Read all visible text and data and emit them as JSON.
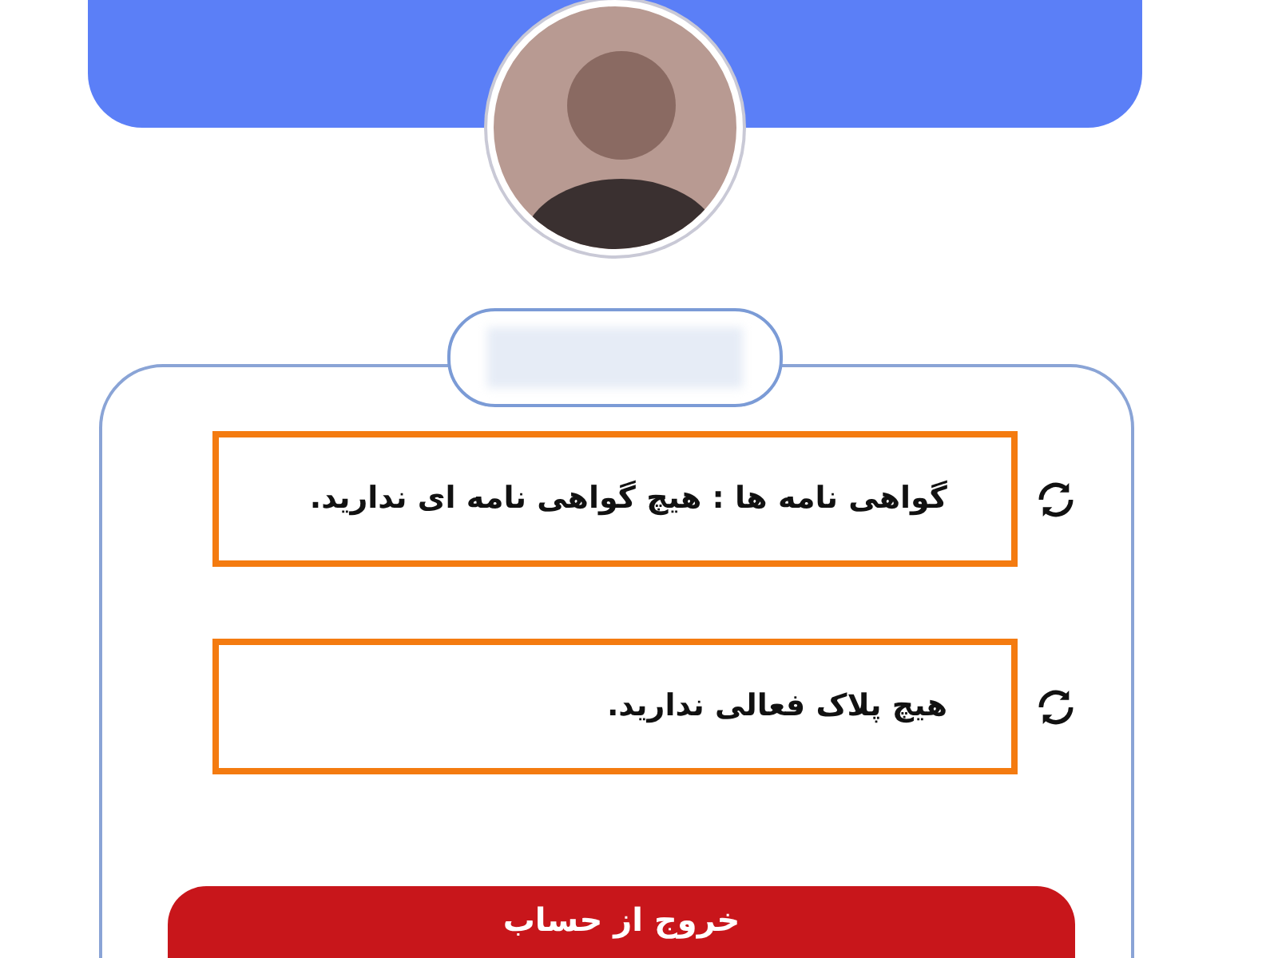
{
  "rows": [
    {
      "text": "گواهی نامه ها : هیچ گواهی نامه ای ندارید.",
      "highlighted": true
    },
    {
      "text": "هیچ پلاک فعالی ندارید.",
      "highlighted": true
    }
  ],
  "logout_button": "خروج از حساب"
}
